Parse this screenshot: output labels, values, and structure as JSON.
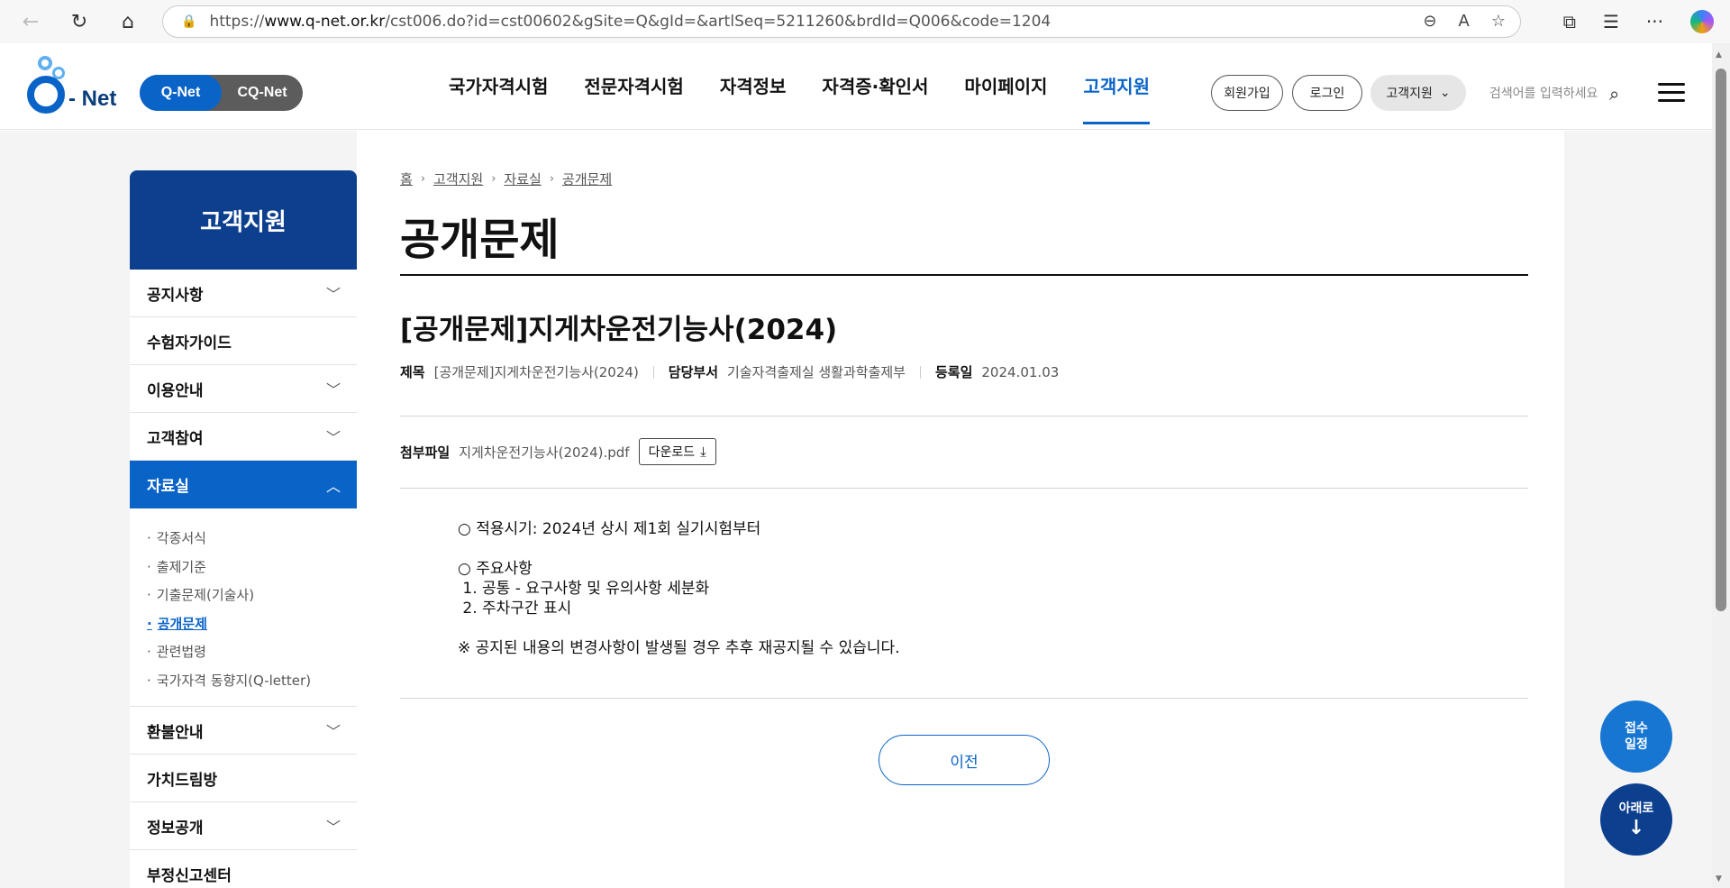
{
  "browser": {
    "url_prefix": "https://",
    "url_host": "www.q-net.or.kr",
    "url_path": "/cst006.do?id=cst00602&gSite=Q&gId=&artlSeq=5211260&brdId=Q006&code=1204"
  },
  "header": {
    "logo_text": "- Net",
    "toggle_on": "Q-Net",
    "toggle_off": "CQ-Net",
    "gnb": [
      "국가자격시험",
      "전문자격시험",
      "자격정보",
      "자격증·확인서",
      "마이페이지",
      "고객지원"
    ],
    "signup": "회원가입",
    "login": "로그인",
    "category": "고객지원",
    "search_placeholder": "검색어를 입력하세요"
  },
  "sidebar": {
    "title": "고객지원",
    "items_top": [
      "공지사항",
      "수험자가이드",
      "이용안내",
      "고객참여"
    ],
    "active": "자료실",
    "sub": [
      "각종서식",
      "출제기준",
      "기출문제(기술사)",
      "공개문제",
      "관련법령",
      "국가자격 동향지(Q-letter)"
    ],
    "items_bottom": [
      "환불안내",
      "가치드림방",
      "정보공개",
      "부정신고센터"
    ]
  },
  "breadcrumb": [
    "홈",
    "고객지원",
    "자료실",
    "공개문제"
  ],
  "page_title": "공개문제",
  "post": {
    "title": "[공개문제]지게차운전기능사(2024)",
    "meta_title_label": "제목",
    "meta_title_value": "[공개문제]지게차운전기능사(2024)",
    "meta_dept_label": "담당부서",
    "meta_dept_value": "기술자격출제실 생활과학출제부",
    "meta_date_label": "등록일",
    "meta_date_value": "2024.01.03",
    "attach_label": "첨부파일",
    "attach_file": "지게차운전기능사(2024).pdf",
    "download_label": "다운로드",
    "body": "○ 적용시기: 2024년 상시 제1회 실기시험부터\n\n○ 주요사항\n 1. 공통 - 요구사항 및 유의사항 세분화\n 2. 주차구간 표시\n\n※ 공지된 내용의 변경사항이 발생될 경우 추후 재공지될 수 있습니다."
  },
  "prev_button": "이전",
  "fab": {
    "schedule_line1": "접수",
    "schedule_line2": "일정",
    "down_label": "아래로"
  }
}
